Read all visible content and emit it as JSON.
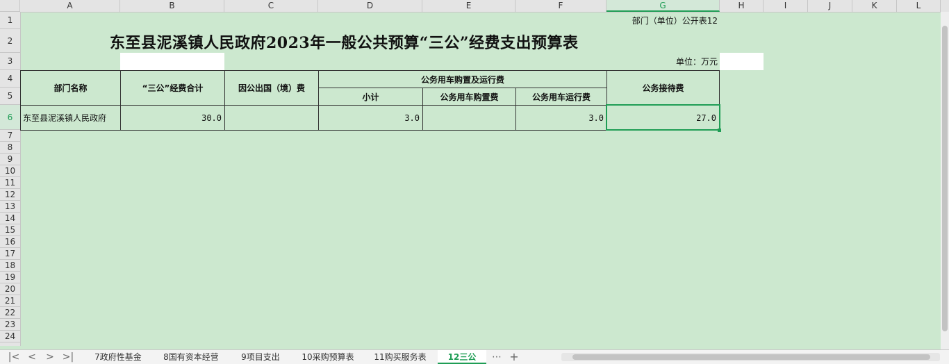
{
  "columns": [
    "A",
    "B",
    "C",
    "D",
    "E",
    "F",
    "G",
    "H",
    "I",
    "J",
    "K",
    "L"
  ],
  "rows": [
    "1",
    "2",
    "3",
    "4",
    "5",
    "6",
    "7",
    "8",
    "9",
    "10",
    "11",
    "12",
    "13",
    "14",
    "15",
    "16",
    "17",
    "18",
    "19",
    "20",
    "21",
    "22",
    "23",
    "24"
  ],
  "active_column": "G",
  "active_row": "6",
  "sheet": {
    "form_label": "部门（单位）公开表12",
    "title": "东至县泥溪镇人民政府2023年一般公共预算“三公”经费支出预算表",
    "unit": "单位：万元",
    "headers": {
      "dept_name": "部门名称",
      "total": "“三公”经费合计",
      "abroad": "因公出国（境）费",
      "vehicle_group": "公务用车购置及运行费",
      "subtotal": "小计",
      "vehicle_purchase": "公务用车购置费",
      "vehicle_operation": "公务用车运行费",
      "reception": "公务接待费"
    },
    "row6": {
      "dept_name": "东至县泥溪镇人民政府",
      "total": "30.0",
      "abroad": "",
      "subtotal": "3.0",
      "vehicle_purchase": "",
      "vehicle_operation": "3.0",
      "reception": "27.0"
    }
  },
  "tabs": [
    "7政府性基金",
    "8国有资本经营",
    "9项目支出",
    "10采购预算表",
    "11购买服务表",
    "12三公"
  ],
  "active_tab": "12三公",
  "tab_more": "⋯",
  "tab_add": "+",
  "nav": {
    "first": "|<",
    "prev": "<",
    "next": ">",
    "last": ">|"
  },
  "colors": {
    "sheet_bg": "#cce8cf",
    "accent": "#1f9d55"
  }
}
